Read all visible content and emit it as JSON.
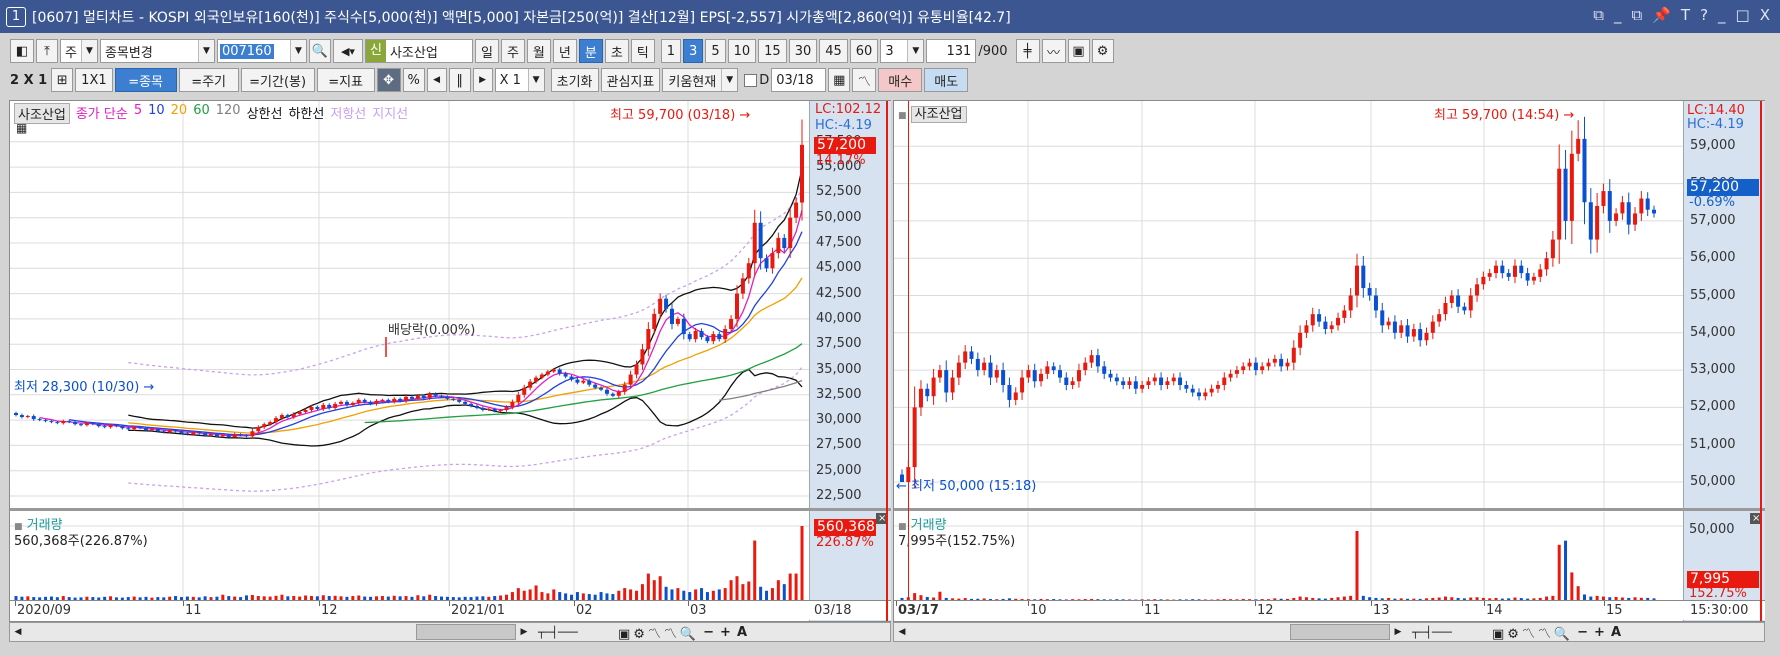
{
  "title": {
    "num": "1",
    "text": "[0607] 멀티차트 - KOSPI 외국인보유[160(천)] 주식수[5,000(천)] 액면[5,000] 자본금[250(억)] 결산[12월] EPS[-2,557] 시가총액[2,860(억)] 유통비율[42.7]",
    "controls": [
      "⧉",
      "_",
      "⧉",
      "📌",
      "T",
      "?",
      "_",
      "□",
      "X"
    ]
  },
  "toolbar1": {
    "market": "주",
    "change": "종목변경",
    "code": "007160",
    "new_badge": "신",
    "stock_name": "사조산업",
    "periods": [
      "일",
      "주",
      "월",
      "년",
      "분",
      "초",
      "틱"
    ],
    "active_period": "분",
    "minutes": [
      "1",
      "3",
      "5",
      "10",
      "15",
      "30",
      "45",
      "60"
    ],
    "active_minute": "3",
    "interval": "3",
    "count": "131",
    "max_count": "/900"
  },
  "toolbar2": {
    "layout": "2 X 1",
    "one": "1X1",
    "item": "=종목",
    "cycle": "=주기",
    "range": "=기간(봉)",
    "indicator": "=지표",
    "percent": "%",
    "zoom": "X 1",
    "reset": "초기화",
    "fav": "관심지표",
    "kiwoom": "키움현재",
    "d_label": "D",
    "date": "03/18",
    "buy": "매수",
    "sell": "매도"
  },
  "left": {
    "stock": "사조산업",
    "legend": [
      {
        "t": "종가 단순",
        "c": "#e020c0"
      },
      {
        "t": "5",
        "c": "#e020c0"
      },
      {
        "t": "10",
        "c": "#2040e0"
      },
      {
        "t": "20",
        "c": "#f0a000"
      },
      {
        "t": "60",
        "c": "#20a040"
      },
      {
        "t": "120",
        "c": "#808080"
      },
      {
        "t": "상한선",
        "c": "#111"
      },
      {
        "t": "하한선",
        "c": "#111"
      },
      {
        "t": "저항선",
        "c": "#c8a0f0"
      },
      {
        "t": "지지선",
        "c": "#c8a0f0"
      }
    ],
    "lc": "LC:102.12",
    "hc": "HC:-4.19",
    "price_tag": "57,200",
    "price_pct": "14.17%",
    "high_note": "최고 59,700 (03/18)",
    "low_note": "최저 28,300 (10/30)",
    "div_note": "배당락(0.00%)",
    "yticks": [
      "57,500",
      "55,000",
      "52,500",
      "50,000",
      "47,500",
      "45,000",
      "42,500",
      "40,000",
      "37,500",
      "35,000",
      "32,500",
      "30,000",
      "27,500",
      "25,000",
      "22,500"
    ],
    "vol_title": "거래량",
    "vol_info": "560,368주(226.87%)",
    "vol_tag": "560,368",
    "vol_pct": "226.87%",
    "xlabels": [
      "2020/09",
      "11",
      "12",
      "2021/01",
      "02",
      "03"
    ],
    "x_end": "03/18"
  },
  "right": {
    "stock": "사조산업",
    "lc": "LC:14.40",
    "hc": "HC:-4.19",
    "price_tag": "57,200",
    "price_pct": "-0.69%",
    "high_note": "최고 59,700 (14:54)",
    "low_note": "최저 50,000 (15:18)",
    "yticks": [
      "59,000",
      "58,000",
      "57,000",
      "56,000",
      "55,000",
      "54,000",
      "53,000",
      "52,000",
      "51,000",
      "50,000"
    ],
    "vol_title": "거래량",
    "vol_info": "7,995주(152.75%)",
    "vol_tick": "50,000",
    "vol_tag": "7,995",
    "vol_pct": "152.75%",
    "xlabels": [
      "03/17",
      "10",
      "11",
      "12",
      "13",
      "14",
      "15"
    ],
    "x_end": "15:30:00"
  },
  "colors": {
    "up": "#e8190f",
    "down": "#0a50d0",
    "ma5": "#e020c0",
    "ma10": "#2040e0",
    "ma20": "#f0a000",
    "ma60": "#20a040",
    "ma120": "#808080",
    "band": "#111111",
    "env": "#c8a0f0"
  },
  "chart_data": [
    {
      "type": "candlestick",
      "name": "daily",
      "ylim": [
        22500,
        60000
      ],
      "last": 57200,
      "high": 59700,
      "low": 28300,
      "closes": [
        30500,
        30300,
        30400,
        30100,
        30000,
        29900,
        29800,
        29700,
        29900,
        29800,
        29600,
        29500,
        29700,
        29600,
        29400,
        29300,
        29500,
        29400,
        29200,
        29100,
        29300,
        29200,
        29000,
        29100,
        28900,
        28800,
        29000,
        28900,
        28700,
        28600,
        28800,
        28700,
        28500,
        28600,
        28400,
        28500,
        28300,
        28600,
        28500,
        28400,
        28900,
        29300,
        29600,
        29800,
        30200,
        30500,
        30300,
        30600,
        30800,
        31000,
        31300,
        31100,
        31500,
        31200,
        31600,
        31800,
        31500,
        31700,
        32000,
        31800,
        31600,
        31900,
        32000,
        31800,
        32100,
        31900,
        32300,
        32100,
        32400,
        32200,
        32600,
        32400,
        32300,
        32100,
        32000,
        31800,
        31600,
        31400,
        31200,
        31000,
        31100,
        30900,
        31000,
        31300,
        31800,
        32500,
        33200,
        33800,
        34200,
        34500,
        34800,
        35000,
        34600,
        34300,
        34000,
        33700,
        33900,
        33500,
        33200,
        33000,
        32600,
        32400,
        32800,
        33500,
        34500,
        35500,
        37000,
        39000,
        40500,
        42000,
        41000,
        39500,
        40000,
        38500,
        38000,
        38800,
        38200,
        37800,
        38500,
        38000,
        39000,
        40000,
        42500,
        44000,
        45500,
        49500,
        46000,
        45000,
        46500,
        48000,
        47000,
        50000,
        51500,
        57200
      ],
      "volumes": [
        30,
        25,
        28,
        22,
        20,
        24,
        26,
        21,
        30,
        22,
        18,
        20,
        25,
        22,
        19,
        24,
        28,
        20,
        18,
        22,
        26,
        20,
        24,
        18,
        22,
        20,
        25,
        30,
        22,
        26,
        24,
        20,
        28,
        22,
        25,
        40,
        30,
        26,
        22,
        35,
        38,
        30,
        28,
        26,
        32,
        40,
        28,
        30,
        26,
        34,
        30,
        28,
        36,
        30,
        32,
        28,
        24,
        30,
        34,
        26,
        24,
        28,
        30,
        26,
        32,
        28,
        30,
        24,
        36,
        28,
        40,
        30,
        26,
        24,
        22,
        20,
        24,
        22,
        26,
        28,
        24,
        30,
        34,
        40,
        60,
        90,
        70,
        80,
        110,
        60,
        50,
        80,
        60,
        50,
        40,
        60,
        50,
        45,
        40,
        60,
        50,
        45,
        70,
        90,
        80,
        70,
        120,
        200,
        150,
        180,
        100,
        80,
        90,
        70,
        60,
        80,
        90,
        60,
        70,
        80,
        90,
        150,
        180,
        120,
        140,
        450,
        100,
        70,
        90,
        150,
        120,
        200,
        200,
        560
      ]
    },
    {
      "type": "candlestick",
      "name": "3-minute",
      "ylim": [
        49500,
        59900
      ],
      "last": 57200,
      "high": 59700,
      "low": 50000,
      "closes": [
        50000,
        50400,
        52000,
        52500,
        52300,
        52800,
        53000,
        52400,
        52800,
        53200,
        53500,
        53300,
        53000,
        53200,
        52800,
        53000,
        52600,
        52200,
        52400,
        52800,
        53000,
        52700,
        52900,
        53100,
        53000,
        52800,
        52600,
        52700,
        53000,
        53200,
        53400,
        53100,
        52900,
        52800,
        52700,
        52600,
        52700,
        52500,
        52600,
        52700,
        52800,
        52600,
        52700,
        52800,
        52600,
        52500,
        52400,
        52300,
        52400,
        52500,
        52600,
        52800,
        52900,
        53000,
        53100,
        53200,
        53000,
        53100,
        53200,
        53300,
        53100,
        53200,
        53600,
        54000,
        54200,
        54500,
        54300,
        54100,
        54200,
        54400,
        54600,
        55000,
        55800,
        55200,
        55000,
        54600,
        54200,
        54300,
        54000,
        54200,
        53900,
        54100,
        53800,
        54000,
        54300,
        54500,
        54800,
        55000,
        54700,
        54600,
        55000,
        55300,
        55500,
        55600,
        55800,
        55600,
        55500,
        55800,
        55600,
        55400,
        55500,
        55700,
        56000,
        56500,
        58400,
        57000,
        58800,
        59200,
        57500,
        56500,
        57400,
        57800,
        57000,
        57200,
        57500,
        56900,
        57200,
        57600,
        57300,
        57200
      ],
      "volumes": [
        1500,
        2000,
        5000,
        3500,
        2200,
        1800,
        6000,
        1500,
        1200,
        1000,
        1400,
        800,
        900,
        1100,
        700,
        600,
        800,
        1200,
        900,
        700,
        600,
        500,
        800,
        600,
        700,
        500,
        400,
        600,
        500,
        700,
        800,
        600,
        500,
        400,
        600,
        500,
        400,
        300,
        500,
        400,
        600,
        500,
        400,
        300,
        500,
        400,
        600,
        500,
        400,
        300,
        500,
        700,
        600,
        500,
        800,
        600,
        500,
        700,
        600,
        1200,
        900,
        800,
        1500,
        2500,
        2000,
        1500,
        1200,
        1000,
        1500,
        2000,
        2500,
        3000,
        50000,
        3000,
        2000,
        1500,
        1200,
        1500,
        1000,
        1200,
        900,
        1000,
        800,
        1200,
        1500,
        1800,
        2500,
        2000,
        1500,
        1200,
        1800,
        2000,
        1500,
        1200,
        1500,
        1000,
        1200,
        1800,
        1400,
        1000,
        1200,
        1500,
        2500,
        3000,
        40000,
        43000,
        20000,
        10000,
        4000,
        2500,
        3000,
        2500,
        2000,
        2200,
        1800,
        1500,
        2000,
        1600,
        1500,
        1200,
        7995
      ]
    }
  ]
}
